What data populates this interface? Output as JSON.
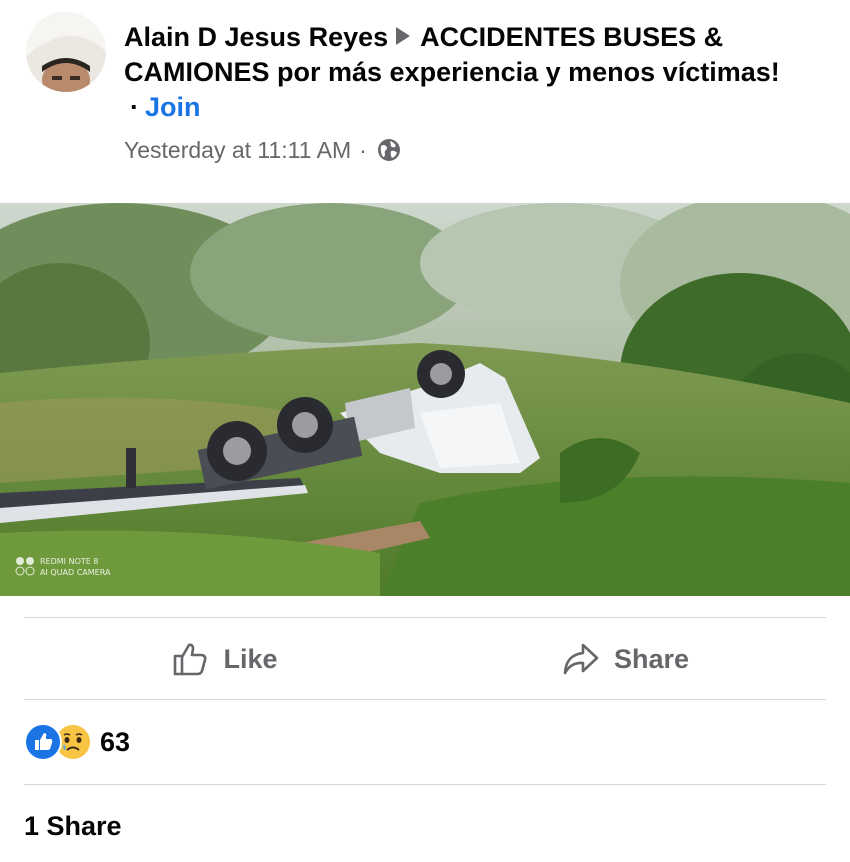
{
  "post": {
    "author": "Alain D Jesus Reyes",
    "group": "ACCIDENTES BUSES & CAMIONES por más experiencia y menos víctimas!",
    "dot": "·",
    "join_label": "Join",
    "timestamp": "Yesterday at 11:11 AM",
    "time_sep": "·",
    "privacy_icon": "globe-icon"
  },
  "photo": {
    "watermark_line1": "REDMI NOTE 8",
    "watermark_line2": "AI QUAD CAMERA"
  },
  "actions": {
    "like_label": "Like",
    "like_icon": "thumbs-up-icon",
    "share_label": "Share",
    "share_icon": "share-arrow-icon"
  },
  "reactions": {
    "icons": [
      "like-reaction-icon",
      "sad-reaction-icon"
    ],
    "count": "63"
  },
  "shares": {
    "label": "1 Share"
  },
  "colors": {
    "link_blue": "#1b74e4",
    "secondary_gray": "#65676b",
    "text": "#050505",
    "divider": "#d6d8dc"
  }
}
